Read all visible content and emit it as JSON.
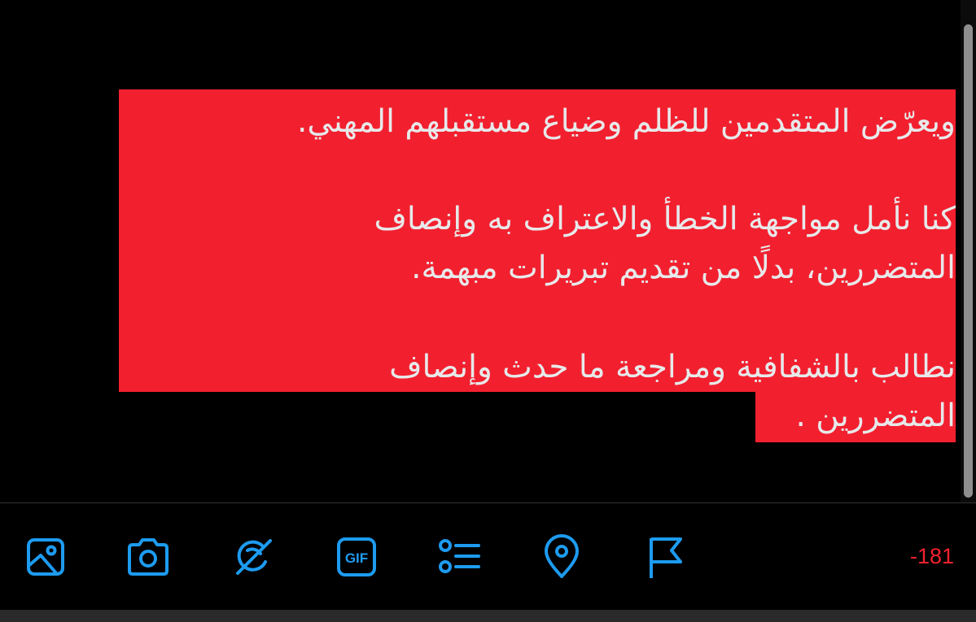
{
  "compose": {
    "lines": [
      "ويعرّض المتقدمين للظلم وضياع مستقبلهم المهني.",
      "كنا نأمل مواجهة الخطأ والاعتراف به وإنصاف",
      "المتضررين، بدلًا من تقديم تبريرات مبهمة.",
      "نطالب بالشفافية ومراجعة ما حدث وإنصاف",
      "المتضررين ."
    ],
    "highlight_color": "#f2202f",
    "text_color": "#e7e9ea"
  },
  "toolbar": {
    "icons": [
      {
        "name": "image-icon"
      },
      {
        "name": "camera-icon"
      },
      {
        "name": "grok-icon"
      },
      {
        "name": "gif-icon",
        "label": "GIF"
      },
      {
        "name": "poll-icon"
      },
      {
        "name": "location-icon"
      },
      {
        "name": "flag-icon"
      }
    ],
    "icon_color": "#1d9bf0",
    "char_counter": "-181",
    "counter_color": "#f4212e"
  }
}
